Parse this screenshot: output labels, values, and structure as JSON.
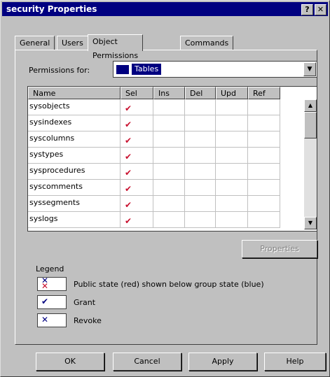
{
  "window": {
    "title": "security Properties",
    "help_glyph": "?",
    "close_glyph": "✕"
  },
  "tabs": [
    {
      "label": "General"
    },
    {
      "label": "Users"
    },
    {
      "label": "Object Permissions",
      "active": true
    },
    {
      "label": "Commands"
    }
  ],
  "permissions_for": {
    "label": "Permissions for:",
    "selected": "Tables",
    "dropdown_glyph": "▼"
  },
  "grid": {
    "columns": [
      "Name",
      "Sel",
      "Ins",
      "Del",
      "Upd",
      "Ref"
    ],
    "rows": [
      {
        "name": "sysobjects",
        "sel": "✔"
      },
      {
        "name": "sysindexes",
        "sel": "✔"
      },
      {
        "name": "syscolumns",
        "sel": "✔"
      },
      {
        "name": "systypes",
        "sel": "✔"
      },
      {
        "name": "sysprocedures",
        "sel": "✔"
      },
      {
        "name": "syscomments",
        "sel": "✔"
      },
      {
        "name": "syssegments",
        "sel": "✔"
      },
      {
        "name": "syslogs",
        "sel": "✔"
      }
    ],
    "scroll_up_glyph": "▲",
    "scroll_down_glyph": "▼"
  },
  "properties_button": "Properties",
  "legend": {
    "title": "Legend",
    "items": [
      {
        "symbol": "✕",
        "text": "Public state (red) shown below group state (blue)"
      },
      {
        "symbol": "✔",
        "text": "Grant"
      },
      {
        "symbol": "✕",
        "text": "Revoke"
      }
    ]
  },
  "buttons": {
    "ok": "OK",
    "cancel": "Cancel",
    "apply": "Apply",
    "help": "Help"
  },
  "colors": {
    "titlebar": "#000080",
    "grant_check": "#c8102e",
    "revoke": "#000080",
    "public_state": "#c8102e"
  }
}
